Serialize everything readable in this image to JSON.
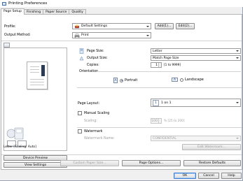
{
  "window": {
    "title": "Printing Preferences"
  },
  "tabs": [
    {
      "label": "Page Setup",
      "active": true
    },
    {
      "label": "Finishing",
      "active": false
    },
    {
      "label": "Paper Source",
      "active": false
    },
    {
      "label": "Quality",
      "active": false
    }
  ],
  "profile": {
    "label": "Profile:",
    "value": "Default Settings",
    "add_label": "Add(1)...",
    "edit_label": "Edit(2)..."
  },
  "output_method": {
    "label": "Output Method:",
    "value": "Print"
  },
  "preview": {
    "caption": "Letter [Scaling: Auto]"
  },
  "left_buttons": {
    "device_preview": "Device Preview",
    "view_settings": "View Settings"
  },
  "page_size": {
    "label": "Page Size:",
    "value": "Letter"
  },
  "output_size": {
    "label": "Output Size:",
    "value": "Match Page Size"
  },
  "copies": {
    "label": "Copies:",
    "value": "1",
    "range": "[1 to 9999]"
  },
  "orientation": {
    "label": "Orientation",
    "portrait": "Portrait",
    "landscape": "Landscape",
    "selected": "Portrait"
  },
  "page_layout": {
    "label": "Page Layout:",
    "value": "1 on 1"
  },
  "manual_scaling": {
    "label": "Manual Scaling",
    "scaling_label": "Scaling:",
    "value": "100",
    "range": "% [25 to 200]"
  },
  "watermark": {
    "label": "Watermark",
    "name_label": "Watermark Name:",
    "value": "CONFIDENTIAL",
    "edit_label": "Edit Watermark..."
  },
  "bottom_buttons": {
    "custom_paper": "Custom Paper Size...",
    "page_options": "Page Options...",
    "restore_defaults": "Restore Defaults"
  },
  "dialog_buttons": {
    "ok": "OK",
    "cancel": "Cancel",
    "help": "Help"
  },
  "colors": {
    "accent": "#1a4fa0",
    "window_bg": "#f0f0f0"
  }
}
